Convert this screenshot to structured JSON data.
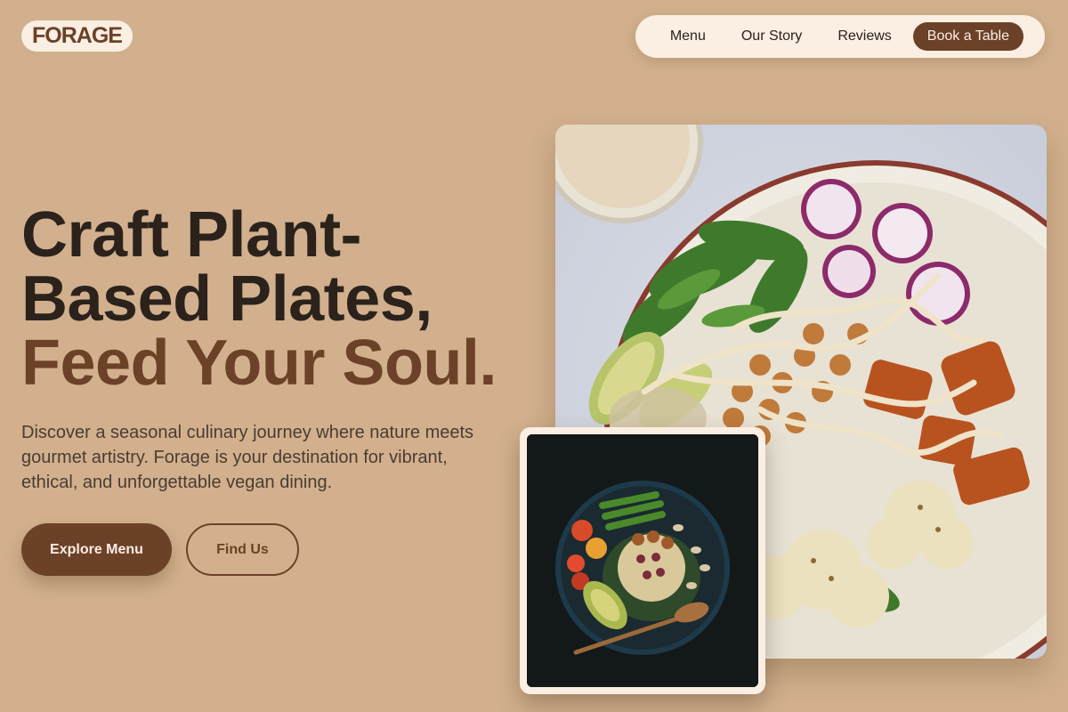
{
  "brand": {
    "logo_text": "FORAGE"
  },
  "nav": {
    "items": [
      "Menu",
      "Our Story",
      "Reviews"
    ],
    "cta_label": "Book a Table"
  },
  "hero": {
    "headline_line1": "Craft Plant-",
    "headline_line2": "Based Plates,",
    "headline_accent": "Feed Your Soul.",
    "description": "Discover a seasonal culinary journey where nature meets gourmet artistry. Forage is your destination for vibrant, ethical, and unforgettable vegan dining.",
    "primary_button": "Explore Menu",
    "secondary_button": "Find Us"
  },
  "images": {
    "main": "buddha-bowl-photo",
    "inset": "dark-bowl-photo"
  },
  "colors": {
    "background": "#d2b08d",
    "accent": "#6b4128",
    "cream": "#fbeee2",
    "text": "#2b221c"
  }
}
